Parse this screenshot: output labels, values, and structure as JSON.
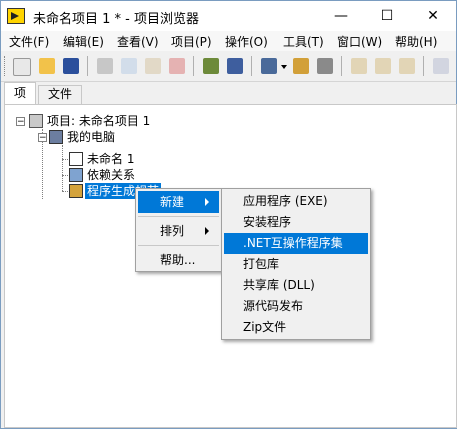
{
  "window": {
    "title": "未命名项目 1 * - 项目浏览器",
    "controls": {
      "minimize": "—",
      "maximize": "☐",
      "close": "✕"
    }
  },
  "menubar": {
    "items": [
      "文件(F)",
      "编辑(E)",
      "查看(V)",
      "项目(P)",
      "操作(O)",
      "工具(T)",
      "窗口(W)",
      "帮助(H)"
    ]
  },
  "toolbar": {
    "buttons": [
      "new-icon",
      "open-icon",
      "save-all-icon",
      "cut-icon",
      "copy-icon",
      "paste-icon",
      "delete-icon",
      "build-icon",
      "save-icon",
      "view-icon",
      "dropdown-icon",
      "plugin-icon",
      "properties-icon",
      "refresh-icon",
      "settings-icon",
      "tool-icon",
      "help-icon"
    ]
  },
  "tabs": [
    {
      "label": "项"
    },
    {
      "label": "文件"
    }
  ],
  "tree": {
    "root": "项目: 未命名项目 1",
    "computer": "我的电脑",
    "vi": "未命名 1",
    "deps": "依赖关系",
    "build": "程序生成规范"
  },
  "context_menu": {
    "items": [
      "新建",
      "排列",
      "帮助..."
    ]
  },
  "submenu": {
    "items": [
      "应用程序 (EXE)",
      "安装程序",
      ".NET互操作程序集",
      "打包库",
      "共享库 (DLL)",
      "源代码发布",
      "Zip文件"
    ],
    "highlighted_index": 2
  },
  "colors": {
    "accent": "#0078d7",
    "title_bg": "#ffffff"
  }
}
